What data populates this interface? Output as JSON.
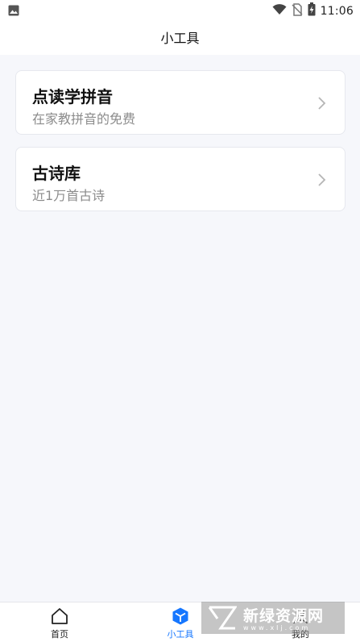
{
  "status_bar": {
    "time": "11:06",
    "icons": [
      "image-icon",
      "wifi-icon",
      "no-sim-icon",
      "battery-charging-icon"
    ]
  },
  "app_bar": {
    "title": "小工具"
  },
  "tools": [
    {
      "title": "点读学拼音",
      "subtitle": "在家教拼音的免费",
      "icon": "chevron-right-icon"
    },
    {
      "title": "古诗库",
      "subtitle": "近1万首古诗",
      "icon": "chevron-right-icon"
    }
  ],
  "tab_bar": {
    "tabs": [
      {
        "label": "首页",
        "icon": "home-icon",
        "active": false
      },
      {
        "label": "小工具",
        "icon": "cube-icon",
        "active": true
      },
      {
        "label": "我的",
        "icon": "user-icon",
        "active": false
      }
    ],
    "active_color": "#1677ff"
  },
  "watermark": {
    "text": "新绿资源网",
    "subtext": "www.xlj.com"
  }
}
